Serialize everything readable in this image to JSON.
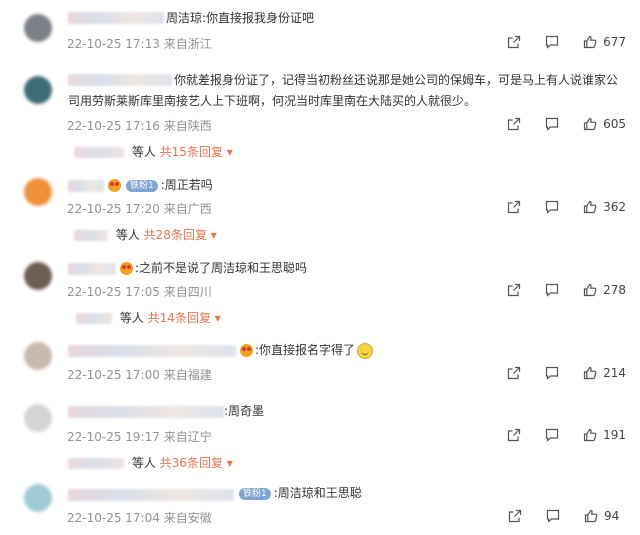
{
  "comments": [
    {
      "text": "周洁琼:你直接报我身份证吧",
      "time": "22-10-25 17:13",
      "location": "来自浙江",
      "likes": "677"
    },
    {
      "text_line1": "你就差报身份证了，记得当初粉丝还说那是她公司的保姆车，可是马上有人说谁家公",
      "text_line2": "司用劳斯莱斯库里南接艺人上下班啊，何况当时库里南在大陆买的人就很少。",
      "time": "22-10-25 17:16",
      "location": "来自陕西",
      "likes": "605",
      "reply_suffix": "等人",
      "reply_count": "共15条回复"
    },
    {
      "badge": "铁粉1",
      "text": ":周正若吗",
      "time": "22-10-25 17:20",
      "location": "来自广西",
      "likes": "362",
      "reply_suffix": "等人",
      "reply_count": "共28条回复"
    },
    {
      "text": ":之前不是说了周洁琼和王思聪吗",
      "time": "22-10-25 17:05",
      "location": "来自四川",
      "likes": "278",
      "reply_suffix": "等人",
      "reply_count": "共14条回复"
    },
    {
      "text": ":你直接报名字得了",
      "time": "22-10-25 17:00",
      "location": "来自福建",
      "likes": "214"
    },
    {
      "text": ":周奇墨",
      "time": "22-10-25 19:17",
      "location": "来自辽宁",
      "likes": "191",
      "reply_suffix": "等人",
      "reply_count": "共36条回复"
    },
    {
      "badge": "铁粉1",
      "text": ":周洁琼和王思聪",
      "time": "22-10-25 17:04",
      "location": "来自安徽",
      "likes": "94"
    }
  ],
  "icons": {
    "share": "share-icon",
    "comment": "comment-icon",
    "like": "like-icon",
    "more": "caret-down-icon"
  },
  "colors": {
    "accent": "#eb7350",
    "meta": "#939393"
  }
}
